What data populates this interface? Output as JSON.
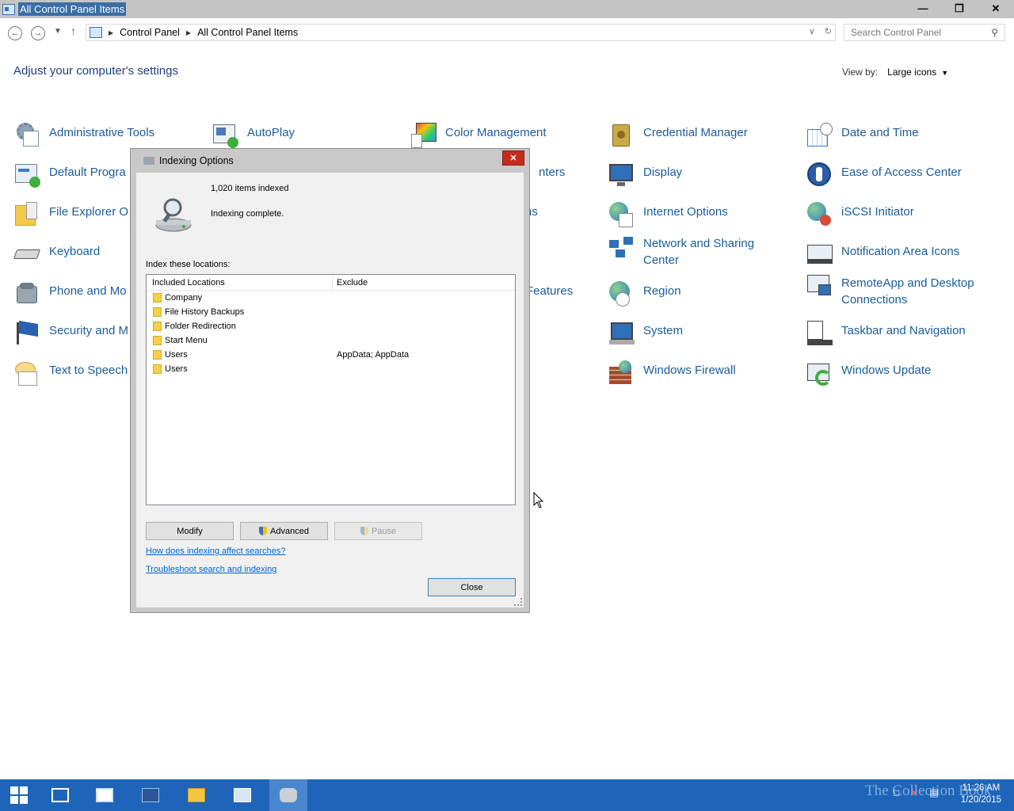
{
  "window": {
    "title": "All Control Panel Items",
    "minimize_glyph": "—",
    "maximize_glyph": "❐",
    "close_glyph": "✕"
  },
  "address": {
    "crumbs": [
      "Control Panel",
      "All Control Panel Items"
    ],
    "search_placeholder": "Search Control Panel"
  },
  "header": {
    "title": "Adjust your computer's settings",
    "view_by_label": "View by:",
    "view_by_value": "Large icons"
  },
  "items": {
    "administrative_tools": "Administrative Tools",
    "autoplay": "AutoPlay",
    "color_management": "Color Management",
    "credential_manager": "Credential Manager",
    "date_and_time": "Date and Time",
    "default_programs": "Default Progra",
    "devices_printers_tail": "nters",
    "display": "Display",
    "ease_of_access": "Ease of Access Center",
    "file_explorer": "File Explorer O",
    "folder_options_tail": "ns",
    "internet_options": "Internet Options",
    "iscsi": "iSCSI Initiator",
    "keyboard": "Keyboard",
    "network_sharing_line1": "Network and Sharing",
    "network_sharing_line2": "Center",
    "notification_icons": "Notification Area Icons",
    "phone_modem": "Phone and Mo",
    "programs_features_tail": "Features",
    "region": "Region",
    "remoteapp_line1": "RemoteApp and Desktop",
    "remoteapp_line2": "Connections",
    "security_maint": "Security and M",
    "system": "System",
    "taskbar_nav": "Taskbar and Navigation",
    "text_to_speech": "Text to Speech",
    "windows_firewall": "Windows Firewall",
    "windows_update": "Windows Update"
  },
  "dialog": {
    "title": "Indexing Options",
    "items_indexed": "1,020 items indexed",
    "status": "Indexing complete.",
    "index_label": "Index these locations:",
    "col_included": "Included Locations",
    "col_exclude": "Exclude",
    "locations": [
      {
        "name": "Company",
        "exclude": ""
      },
      {
        "name": "File History Backups",
        "exclude": ""
      },
      {
        "name": "Folder Redirection",
        "exclude": ""
      },
      {
        "name": "Start Menu",
        "exclude": ""
      },
      {
        "name": "Users",
        "exclude": "AppData; AppData"
      },
      {
        "name": "Users",
        "exclude": ""
      }
    ],
    "modify_label": "Modify",
    "advanced_label": "Advanced",
    "pause_label": "Pause",
    "link_affect": "How does indexing affect searches?",
    "link_troubleshoot": "Troubleshoot search and indexing",
    "close_label": "Close"
  },
  "taskbar": {
    "watermark": "The Collection Book",
    "time": "11:26 AM",
    "date": "1/20/2015"
  },
  "colors": {
    "link_green": "#1a5c9c",
    "taskbar_blue": "#1e65b9",
    "close_red": "#c42b1c"
  }
}
